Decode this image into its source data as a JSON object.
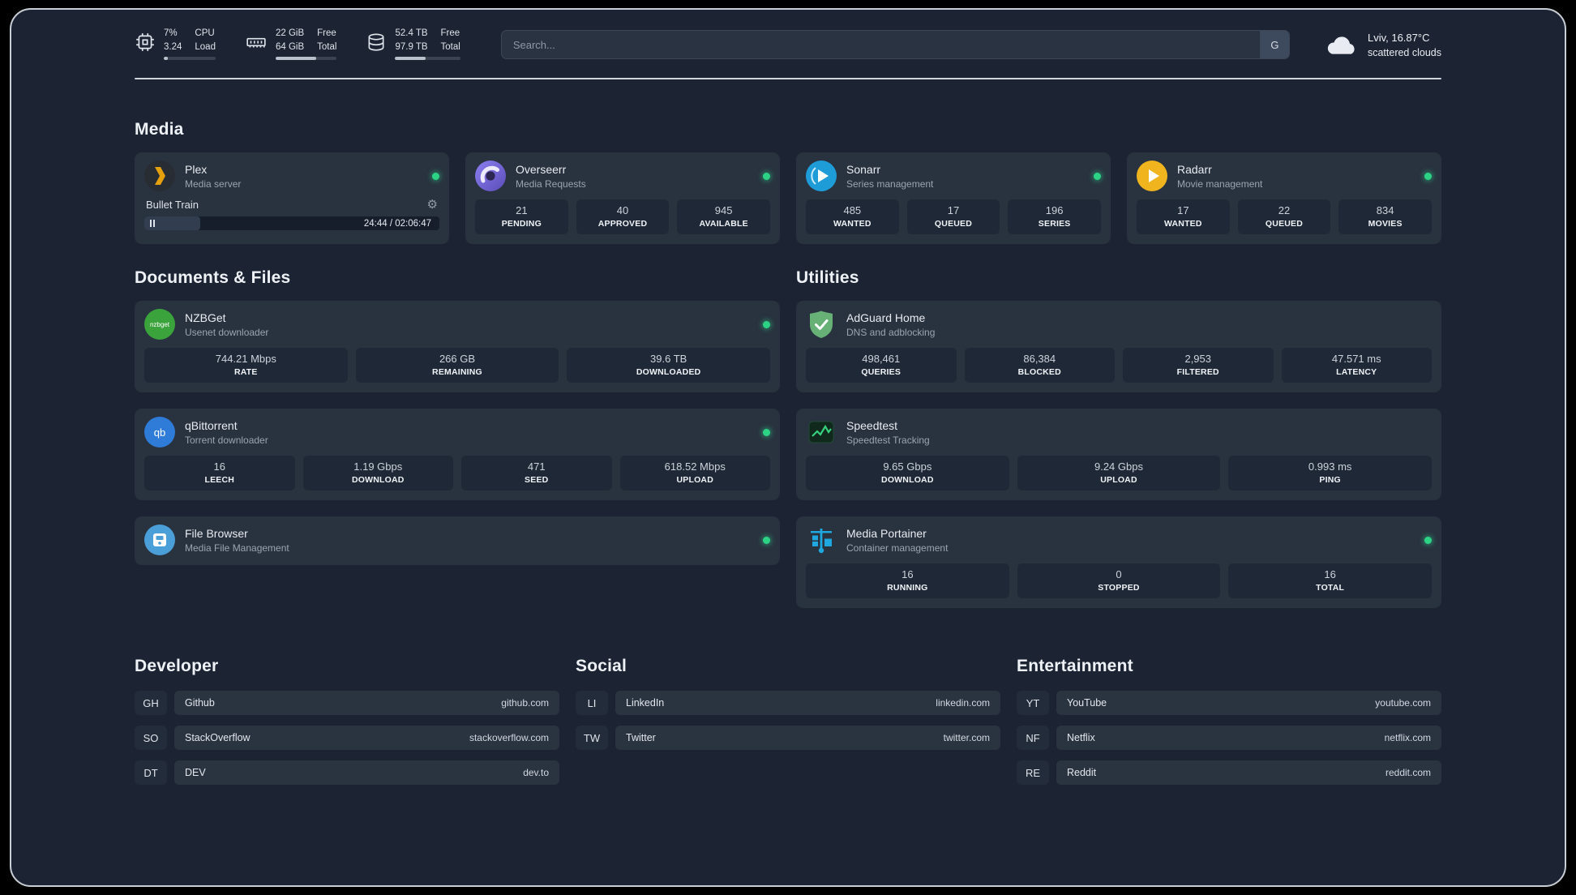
{
  "colors": {
    "status_online": "#2dd385",
    "plex_accent": "#e5a00d",
    "cpu_bar": "#e6a23c"
  },
  "topbar": {
    "cpu": {
      "values": [
        "7%",
        "3.24"
      ],
      "labels": [
        "CPU",
        "Load"
      ],
      "bar_percent": 8
    },
    "memory": {
      "values": [
        "22 GiB",
        "64 GiB"
      ],
      "labels": [
        "Free",
        "Total"
      ],
      "bar_percent": 66
    },
    "disk": {
      "values": [
        "52.4 TB",
        "97.9 TB"
      ],
      "labels": [
        "Free",
        "Total"
      ],
      "bar_percent": 47
    },
    "search": {
      "placeholder": "Search...",
      "provider_label": "G"
    },
    "weather": {
      "location": "Lviv, 16.87°C",
      "condition": "scattered clouds"
    }
  },
  "media": {
    "title": "Media",
    "plex": {
      "name": "Plex",
      "subtitle": "Media server",
      "status": "online",
      "player": {
        "track": "Bullet Train",
        "time": "24:44 / 02:06:47",
        "progress_percent": 19
      }
    },
    "overseerr": {
      "name": "Overseerr",
      "subtitle": "Media Requests",
      "status": "online",
      "stats": [
        {
          "value": "21",
          "label": "PENDING"
        },
        {
          "value": "40",
          "label": "APPROVED"
        },
        {
          "value": "945",
          "label": "AVAILABLE"
        }
      ]
    },
    "sonarr": {
      "name": "Sonarr",
      "subtitle": "Series management",
      "status": "online",
      "stats": [
        {
          "value": "485",
          "label": "WANTED"
        },
        {
          "value": "17",
          "label": "QUEUED"
        },
        {
          "value": "196",
          "label": "SERIES"
        }
      ]
    },
    "radarr": {
      "name": "Radarr",
      "subtitle": "Movie management",
      "status": "online",
      "stats": [
        {
          "value": "17",
          "label": "WANTED"
        },
        {
          "value": "22",
          "label": "QUEUED"
        },
        {
          "value": "834",
          "label": "MOVIES"
        }
      ]
    }
  },
  "documents": {
    "title": "Documents & Files",
    "nzbget": {
      "name": "NZBGet",
      "subtitle": "Usenet downloader",
      "status": "online",
      "stats": [
        {
          "value": "744.21 Mbps",
          "label": "RATE"
        },
        {
          "value": "266 GB",
          "label": "REMAINING"
        },
        {
          "value": "39.6 TB",
          "label": "DOWNLOADED"
        }
      ]
    },
    "qbittorrent": {
      "name": "qBittorrent",
      "subtitle": "Torrent downloader",
      "status": "online",
      "stats": [
        {
          "value": "16",
          "label": "LEECH"
        },
        {
          "value": "1.19 Gbps",
          "label": "DOWNLOAD"
        },
        {
          "value": "471",
          "label": "SEED"
        },
        {
          "value": "618.52 Mbps",
          "label": "UPLOAD"
        }
      ]
    },
    "filebrowser": {
      "name": "File Browser",
      "subtitle": "Media File Management",
      "status": "online"
    }
  },
  "utilities": {
    "title": "Utilities",
    "adguard": {
      "name": "AdGuard Home",
      "subtitle": "DNS and adblocking",
      "stats": [
        {
          "value": "498,461",
          "label": "QUERIES"
        },
        {
          "value": "86,384",
          "label": "BLOCKED"
        },
        {
          "value": "2,953",
          "label": "FILTERED"
        },
        {
          "value": "47.571 ms",
          "label": "LATENCY"
        }
      ]
    },
    "speedtest": {
      "name": "Speedtest",
      "subtitle": "Speedtest Tracking",
      "stats": [
        {
          "value": "9.65 Gbps",
          "label": "DOWNLOAD"
        },
        {
          "value": "9.24 Gbps",
          "label": "UPLOAD"
        },
        {
          "value": "0.993 ms",
          "label": "PING"
        }
      ]
    },
    "portainer": {
      "name": "Media Portainer",
      "subtitle": "Container management",
      "status": "online",
      "stats": [
        {
          "value": "16",
          "label": "RUNNING"
        },
        {
          "value": "0",
          "label": "STOPPED"
        },
        {
          "value": "16",
          "label": "TOTAL"
        }
      ]
    }
  },
  "bookmarks": {
    "developer": {
      "title": "Developer",
      "items": [
        {
          "abbr": "GH",
          "name": "Github",
          "domain": "github.com"
        },
        {
          "abbr": "SO",
          "name": "StackOverflow",
          "domain": "stackoverflow.com"
        },
        {
          "abbr": "DT",
          "name": "DEV",
          "domain": "dev.to"
        }
      ]
    },
    "social": {
      "title": "Social",
      "items": [
        {
          "abbr": "LI",
          "name": "LinkedIn",
          "domain": "linkedin.com"
        },
        {
          "abbr": "TW",
          "name": "Twitter",
          "domain": "twitter.com"
        }
      ]
    },
    "entertainment": {
      "title": "Entertainment",
      "items": [
        {
          "abbr": "YT",
          "name": "YouTube",
          "domain": "youtube.com"
        },
        {
          "abbr": "NF",
          "name": "Netflix",
          "domain": "netflix.com"
        },
        {
          "abbr": "RE",
          "name": "Reddit",
          "domain": "reddit.com"
        }
      ]
    }
  }
}
